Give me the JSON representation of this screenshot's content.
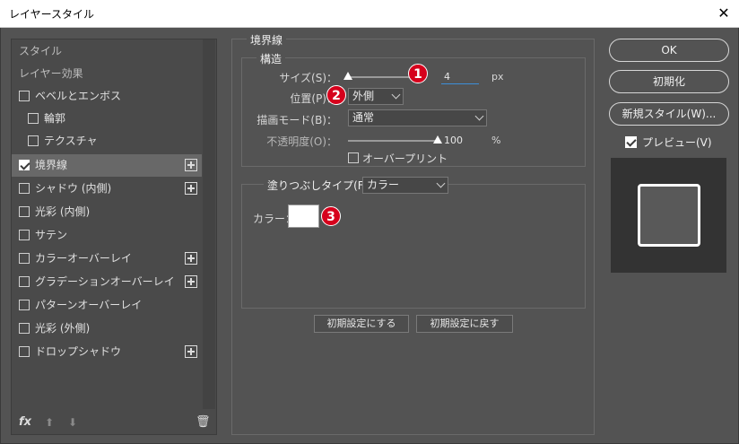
{
  "window": {
    "title": "レイヤースタイル",
    "close": "✕"
  },
  "left_panel": {
    "header_styles": "スタイル",
    "header_effects": "レイヤー効果",
    "items": [
      {
        "label": "ベベルとエンボス",
        "checked": false,
        "has_add": false
      },
      {
        "label": "輪郭",
        "checked": false,
        "has_add": false
      },
      {
        "label": "テクスチャ",
        "checked": false,
        "has_add": false
      },
      {
        "label": "境界線",
        "checked": true,
        "has_add": true
      },
      {
        "label": "シャドウ (内側)",
        "checked": false,
        "has_add": true
      },
      {
        "label": "光彩 (内側)",
        "checked": false,
        "has_add": false
      },
      {
        "label": "サテン",
        "checked": false,
        "has_add": false
      },
      {
        "label": "カラーオーバーレイ",
        "checked": false,
        "has_add": true
      },
      {
        "label": "グラデーションオーバーレイ",
        "checked": false,
        "has_add": true
      },
      {
        "label": "パターンオーバーレイ",
        "checked": false,
        "has_add": false
      },
      {
        "label": "光彩 (外側)",
        "checked": false,
        "has_add": false
      },
      {
        "label": "ドロップシャドウ",
        "checked": false,
        "has_add": true
      }
    ],
    "footer": {
      "fx": "fx",
      "up": "⬆",
      "down": "⬇",
      "trash": "🗑"
    }
  },
  "stroke": {
    "section_title": "境界線",
    "structure_title": "構造",
    "size_label": "サイズ(S)：",
    "size_value": "4",
    "size_unit": "px",
    "position_label": "位置(P)：",
    "position_value": "外側",
    "blend_label": "描画モード(B)：",
    "blend_value": "通常",
    "opacity_label": "不透明度(O)：",
    "opacity_value": "100",
    "opacity_unit": "%",
    "overprint_label": "オーバープリント",
    "fill_type_label": "塗りつぶしタイプ(F)：",
    "fill_type_value": "カラー",
    "color_label": "カラー：",
    "color_value": "#ffffff",
    "btn_make_default": "初期設定にする",
    "btn_reset_default": "初期設定に戻す"
  },
  "badges": [
    "1",
    "2",
    "3"
  ],
  "right_panel": {
    "ok": "OK",
    "reset": "初期化",
    "new_style": "新規スタイル(W)...",
    "preview_label": "プレビュー(V)"
  }
}
